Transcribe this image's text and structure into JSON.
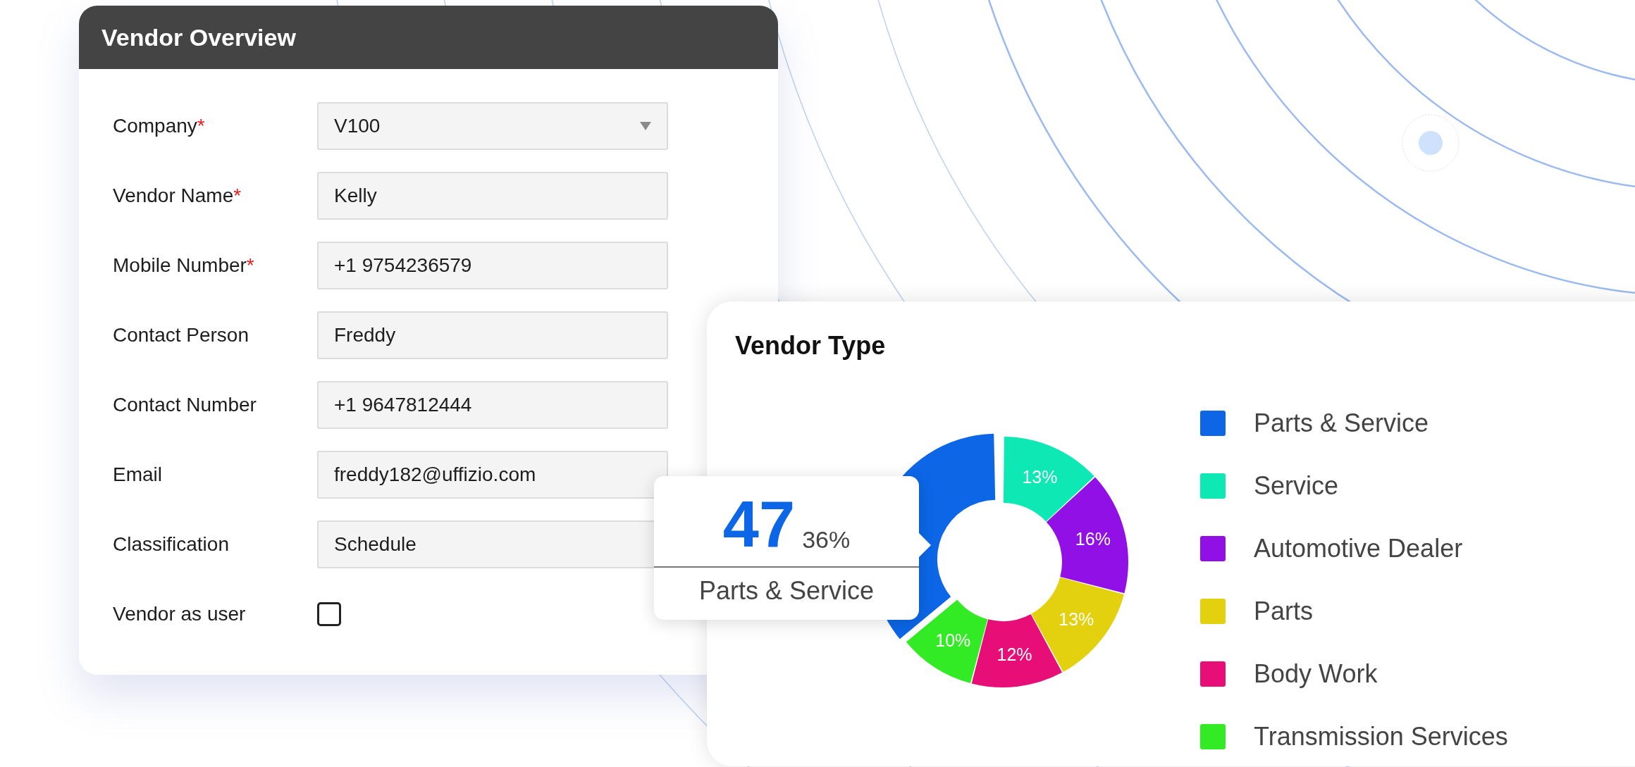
{
  "form": {
    "title": "Vendor Overview",
    "fields": [
      {
        "kind": "select",
        "label": "Company",
        "required_mark": "*",
        "value": "V100"
      },
      {
        "kind": "text",
        "label": "Vendor Name",
        "required_mark": "*",
        "value": "Kelly"
      },
      {
        "kind": "text",
        "label": "Mobile Number",
        "required_mark": "*",
        "value": "+1 9754236579"
      },
      {
        "kind": "text",
        "label": "Contact Person",
        "value": "Freddy"
      },
      {
        "kind": "text",
        "label": "Contact Number",
        "value": "+1 9647812444"
      },
      {
        "kind": "text",
        "label": "Email",
        "value": "freddy182@uffizio.com"
      },
      {
        "kind": "text",
        "label": "Classification",
        "value": "Schedule"
      },
      {
        "kind": "checkbox",
        "label": "Vendor as user",
        "checked": false
      }
    ]
  },
  "vendor_type": {
    "chart_data": {
      "type": "donut",
      "title": "Vendor Type",
      "categories": [
        "Parts & Service",
        "Service",
        "Automotive Dealer",
        "Parts",
        "Body Work",
        "Transmission Services"
      ],
      "series": [
        {
          "colors": [
            "#0c66e6",
            "#0de8b4",
            "#9010e6",
            "#e3d00e",
            "#e80e78",
            "#33eb24"
          ],
          "values": [
            36,
            13,
            16,
            13,
            12,
            10
          ]
        }
      ],
      "value_labels": [
        null,
        "13%",
        "16%",
        "13%",
        "12%",
        "10%"
      ]
    },
    "tooltip": {
      "value": "47",
      "percent": "36%",
      "label": "Parts & Service"
    }
  }
}
